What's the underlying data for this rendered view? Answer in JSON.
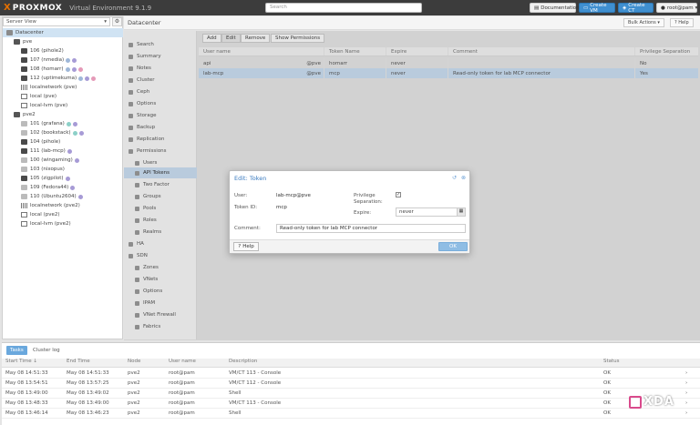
{
  "header": {
    "logo_mark": "X",
    "logo_text": "PROXMOX",
    "product": "Virtual Environment 9.1.9",
    "search_placeholder": "Search",
    "documentation": "Documentation",
    "create_vm": "Create VM",
    "create_ct": "Create CT",
    "user": "root@pam"
  },
  "left": {
    "view": "Server View",
    "tree": [
      {
        "label": "Datacenter",
        "icon": "folder",
        "indent": 0,
        "selected": true,
        "tags": []
      },
      {
        "label": "pve",
        "icon": "node",
        "indent": 1,
        "tags": []
      },
      {
        "label": "106 (pihole2)",
        "icon": "vm",
        "indent": 2,
        "tags": []
      },
      {
        "label": "107 (nmedia)",
        "icon": "vm",
        "indent": 2,
        "tags": [
          "blue",
          "purple"
        ]
      },
      {
        "label": "108 (homarr)",
        "icon": "vm",
        "indent": 2,
        "tags": [
          "blue",
          "purple",
          "pink"
        ]
      },
      {
        "label": "112 (uptimekuma)",
        "icon": "vm",
        "indent": 2,
        "tags": [
          "blue",
          "purple",
          "pink"
        ]
      },
      {
        "label": "localnetwork (pve)",
        "icon": "net",
        "indent": 2,
        "tags": []
      },
      {
        "label": "local (pve)",
        "icon": "stor",
        "indent": 2,
        "tags": []
      },
      {
        "label": "local-lvm (pve)",
        "icon": "stor",
        "indent": 2,
        "tags": []
      },
      {
        "label": "pve2",
        "icon": "node",
        "indent": 1,
        "tags": []
      },
      {
        "label": "101 (grafana)",
        "icon": "vm-off",
        "indent": 2,
        "tags": [
          "teal",
          "purple"
        ]
      },
      {
        "label": "102 (bookstack)",
        "icon": "vm-off",
        "indent": 2,
        "tags": [
          "teal",
          "purple"
        ]
      },
      {
        "label": "104 (pihole)",
        "icon": "vm",
        "indent": 2,
        "tags": []
      },
      {
        "label": "111 (lab-mcp)",
        "icon": "vm",
        "indent": 2,
        "tags": [
          "purple"
        ]
      },
      {
        "label": "100 (wingaming)",
        "icon": "vm-off",
        "indent": 2,
        "tags": [
          "purple"
        ]
      },
      {
        "label": "103 (nixopus)",
        "icon": "vm-off",
        "indent": 2,
        "tags": []
      },
      {
        "label": "105 (zigpilot)",
        "icon": "vm",
        "indent": 2,
        "tags": [
          "purple"
        ]
      },
      {
        "label": "109 (Fedora44)",
        "icon": "vm-off",
        "indent": 2,
        "tags": [
          "purple"
        ]
      },
      {
        "label": "110 (Ubuntu2604)",
        "icon": "vm-off",
        "indent": 2,
        "tags": [
          "purple"
        ]
      },
      {
        "label": "localnetwork (pve2)",
        "icon": "net",
        "indent": 2,
        "tags": []
      },
      {
        "label": "local (pve2)",
        "icon": "stor",
        "indent": 2,
        "tags": []
      },
      {
        "label": "local-lvm (pve2)",
        "icon": "stor",
        "indent": 2,
        "tags": []
      }
    ]
  },
  "datacenter": {
    "title": "Datacenter",
    "bulk_actions": "Bulk Actions",
    "help": "Help"
  },
  "nav": [
    {
      "label": "Search",
      "sub": false
    },
    {
      "label": "Summary",
      "sub": false
    },
    {
      "label": "Notes",
      "sub": false
    },
    {
      "label": "Cluster",
      "sub": false
    },
    {
      "label": "Ceph",
      "sub": false
    },
    {
      "label": "Options",
      "sub": false
    },
    {
      "label": "Storage",
      "sub": false
    },
    {
      "label": "Backup",
      "sub": false
    },
    {
      "label": "Replication",
      "sub": false
    },
    {
      "label": "Permissions",
      "sub": false
    },
    {
      "label": "Users",
      "sub": true
    },
    {
      "label": "API Tokens",
      "sub": true,
      "selected": true
    },
    {
      "label": "Two Factor",
      "sub": true
    },
    {
      "label": "Groups",
      "sub": true
    },
    {
      "label": "Pools",
      "sub": true
    },
    {
      "label": "Roles",
      "sub": true
    },
    {
      "label": "Realms",
      "sub": true
    },
    {
      "label": "HA",
      "sub": false
    },
    {
      "label": "SDN",
      "sub": false
    },
    {
      "label": "Zones",
      "sub": true
    },
    {
      "label": "VNets",
      "sub": true
    },
    {
      "label": "Options",
      "sub": true
    },
    {
      "label": "IPAM",
      "sub": true
    },
    {
      "label": "VNet Firewall",
      "sub": true
    },
    {
      "label": "Fabrics",
      "sub": true
    }
  ],
  "tokens": {
    "toolbar": {
      "add": "Add",
      "edit": "Edit",
      "remove": "Remove",
      "show_permissions": "Show Permissions"
    },
    "columns": [
      "User name",
      "Token Name",
      "Expire",
      "Comment",
      "Privilege Separation"
    ],
    "rows": [
      [
        "api",
        "homarr",
        "never",
        "",
        "No"
      ],
      [
        "lab-mcp",
        "mcp",
        "never",
        "Read-only token for lab MCP connector",
        "Yes"
      ]
    ],
    "realm_suffix": "@pve"
  },
  "dialog": {
    "title": "Edit: Token",
    "user_label": "User:",
    "user_value": "lab-mcp@pve",
    "token_label": "Token ID:",
    "token_value": "mcp",
    "priv_label_1": "Privilege",
    "priv_label_2": "Separation:",
    "priv_checked": "✓",
    "expire_label": "Expire:",
    "expire_value": "never",
    "comment_label": "Comment:",
    "comment_value": "Read-only token for lab MCP connector",
    "help": "Help",
    "ok": "OK"
  },
  "log": {
    "tabs": [
      "Tasks",
      "Cluster log"
    ],
    "columns": [
      "Start Time ↓",
      "End Time",
      "Node",
      "User name",
      "Description",
      "Status"
    ],
    "rows": [
      [
        "May 08 14:51:33",
        "May 08 14:51:33",
        "pve2",
        "root@pam",
        "VM/CT 113 - Console",
        "OK"
      ],
      [
        "May 08 13:54:51",
        "May 08 13:57:25",
        "pve2",
        "root@pam",
        "VM/CT 112 - Console",
        "OK"
      ],
      [
        "May 08 13:49:00",
        "May 08 13:49:02",
        "pve2",
        "root@pam",
        "Shell",
        "OK"
      ],
      [
        "May 08 13:48:33",
        "May 08 13:49:00",
        "pve2",
        "root@pam",
        "VM/CT 113 - Console",
        "OK"
      ],
      [
        "May 08 13:46:14",
        "May 08 13:46:23",
        "pve2",
        "root@pam",
        "Shell",
        "OK"
      ]
    ]
  },
  "watermark": "XDA"
}
